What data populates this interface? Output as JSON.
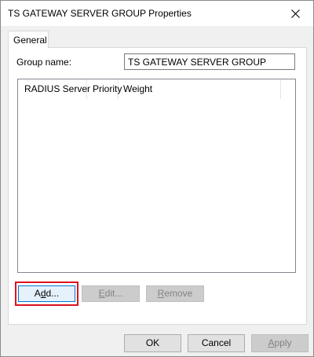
{
  "window": {
    "title": "TS GATEWAY SERVER GROUP Properties",
    "close_icon": "close-icon"
  },
  "tabs": [
    {
      "label": "General",
      "selected": true
    }
  ],
  "general": {
    "group_name_label": "Group name:",
    "group_name_value": "TS GATEWAY SERVER GROUP",
    "list_columns": [
      "RADIUS Server",
      "Priority",
      "Weight"
    ],
    "list_rows": [],
    "buttons": {
      "add": {
        "pre": "A",
        "mnemonic": "d",
        "post": "d...",
        "enabled": true
      },
      "edit": {
        "pre": "",
        "mnemonic": "E",
        "post": "dit...",
        "enabled": false
      },
      "remove": {
        "pre": "",
        "mnemonic": "R",
        "post": "emove",
        "enabled": false
      }
    }
  },
  "footer": {
    "ok": "OK",
    "cancel": "Cancel",
    "apply": {
      "pre": "",
      "mnemonic": "A",
      "post": "pply",
      "enabled": false
    }
  },
  "colors": {
    "highlight_border": "#d9141e",
    "focus_border": "#0078d7"
  }
}
